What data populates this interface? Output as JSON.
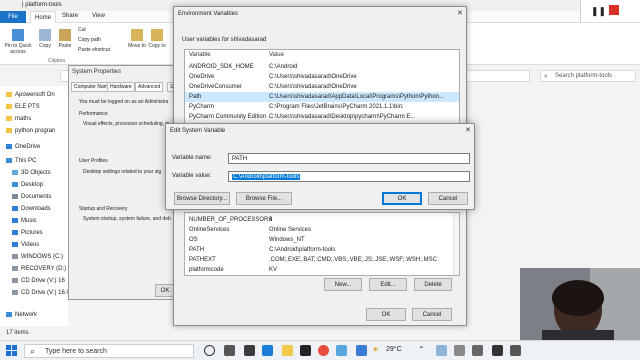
{
  "explorer": {
    "title": "| platform-tools",
    "tabs": [
      "File",
      "Home",
      "Share",
      "View"
    ],
    "ribbon": [
      "Pin to Quick access",
      "Copy",
      "Paste",
      "Cut",
      "Copy path",
      "Paste shortcut",
      "Move to",
      "Copy to"
    ],
    "clipboard_group": "Clipboa",
    "search_placeholder": "Search platform-tools",
    "nav_items": [
      {
        "label": "Apowersoft On",
        "color": "#f4c542"
      },
      {
        "label": "ELE PTS",
        "color": "#f4c542"
      },
      {
        "label": "maths",
        "color": "#f4c542"
      },
      {
        "label": "python progran",
        "color": "#f4c542"
      },
      {
        "label": "OneDrive",
        "color": "#2f7fd8"
      },
      {
        "label": "This PC",
        "color": "#3c8fd8"
      },
      {
        "label": "3D Objects",
        "color": "#5fa8e0"
      },
      {
        "label": "Desktop",
        "color": "#3f8fd6"
      },
      {
        "label": "Documents",
        "color": "#7c8a99"
      },
      {
        "label": "Downloads",
        "color": "#2f7fd8"
      },
      {
        "label": "Music",
        "color": "#2f7fd8"
      },
      {
        "label": "Pictures",
        "color": "#2f7fd8"
      },
      {
        "label": "Videos",
        "color": "#2f7fd8"
      },
      {
        "label": "WINDOWS (C:)",
        "color": "#8a96a3"
      },
      {
        "label": "RECOVERY (D:)",
        "color": "#8a96a3"
      },
      {
        "label": "CD Drive (V:) 16",
        "color": "#8a96a3"
      },
      {
        "label": "CD Drive (V:) 16.0",
        "color": "#8a96a3"
      },
      {
        "label": "Network",
        "color": "#3c8fd8"
      }
    ],
    "status": "17 items"
  },
  "sysprops": {
    "title": "System Properties",
    "tabs": [
      "Computer Name",
      "Hardware",
      "Advanced",
      "S"
    ],
    "logon_text": "You must be logged on as an Administra",
    "performance_label": "Performance",
    "performance_text": "Visual effects, processor scheduling, m",
    "profiles_label": "User Profiles",
    "profiles_text": "Desktop settings related to your sig",
    "startup_label": "Startup and Recovery",
    "startup_text": "System startup, system failure, and deb",
    "ok_label": "OK"
  },
  "env": {
    "title": "Environment Variables",
    "user_section": "User variables for shivadasarad",
    "col_variable": "Variable",
    "col_value": "Value",
    "user_vars": [
      {
        "name": "ANDROID_SDK_HOME",
        "value": "C:\\Android"
      },
      {
        "name": "OneDrive",
        "value": "C:\\Users\\shivadasarad\\OneDrive"
      },
      {
        "name": "OneDriveConsumer",
        "value": "C:\\Users\\shivadasarad\\OneDrive"
      },
      {
        "name": "Path",
        "value": "C:\\Users\\shivadasarad\\AppData\\Local\\Programs\\Python\\Python..."
      },
      {
        "name": "PyCharm",
        "value": "C:\\Program Files\\JetBrains\\PyCharm 2021.1.1\\bin;"
      },
      {
        "name": "PyCharm Community Edition",
        "value": "C:\\Users\\shivadasarad\\Desktop\\pycharm\\PyCharm E..."
      },
      {
        "name": "TEMP",
        "value": "C:\\Users\\shivadasarad\\AppData\\Local\\Temp"
      }
    ],
    "sys_vars": [
      {
        "name": "NUMBER_OF_PROCESSORS",
        "value": "4"
      },
      {
        "name": "OnlineServices",
        "value": "Online Services"
      },
      {
        "name": "OS",
        "value": "Windows_NT"
      },
      {
        "name": "PATH",
        "value": "C:\\Android\\platform-tools"
      },
      {
        "name": "PATHEXT",
        "value": ".COM;.EXE;.BAT;.CMD;.VBS;.VBE;.JS;.JSE;.WSF;.WSH;.MSC"
      },
      {
        "name": "platformcode",
        "value": "KV"
      }
    ],
    "new_label": "New...",
    "edit_label": "Edit...",
    "delete_label": "Delete",
    "ok_label": "OK",
    "cancel_label": "Cancel"
  },
  "edit": {
    "title": "Edit System Variable",
    "name_label": "Variable name:",
    "name_value": "PATH",
    "value_label": "Variable value:",
    "value_value": "C:\\Android\\platform-tools",
    "browse_dir": "Browse Directory...",
    "browse_file": "Browse File...",
    "ok_label": "OK",
    "cancel_label": "Cancel"
  },
  "taskbar": {
    "search_placeholder": "Type here to search",
    "temperature": "29°C"
  }
}
